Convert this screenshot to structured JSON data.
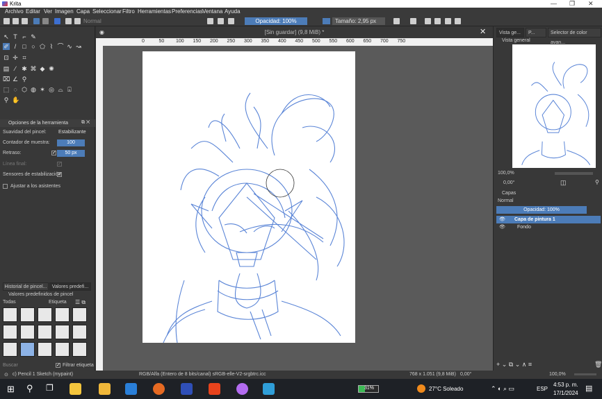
{
  "window": {
    "app_title": "Krita"
  },
  "menu": [
    "Archivo",
    "Editar",
    "Ver",
    "Imagen",
    "Capa",
    "Seleccionar",
    "Filtro",
    "Herramientas",
    "Preferencias",
    "Ventana",
    "Ayuda"
  ],
  "toolbar": {
    "blend_mode": "Normal",
    "opacity_label": "Opacidad: 100%",
    "size_label": "Tamaño: 2,95 px"
  },
  "document": {
    "tab_title": "[Sin guardar]  (9,8 MiB) *",
    "ruler_ticks": [
      "0",
      "50",
      "100",
      "150",
      "200",
      "250",
      "300",
      "350",
      "400",
      "450",
      "500",
      "550",
      "600",
      "650",
      "700",
      "750"
    ]
  },
  "tool_options": {
    "title": "Opciones de la herramienta",
    "smoothing_label": "Suavidad del pincel:",
    "smoothing_value": "Estabilizante",
    "sample_count_label": "Contador de muestra:",
    "sample_count_value": "100",
    "delay_label": "Retraso:",
    "delay_value": "50 px",
    "finish_line_label": "Línea final:",
    "stabilize_sensors_label": "Sensores de estabilización:",
    "snap_assistants_label": "Ajustar a los asistentes"
  },
  "brush_presets": {
    "tab_history": "Historial de pincel...",
    "tab_presets": "Valores predefi...",
    "title": "Valores predefinidos de pincel",
    "filter_all": "Todas",
    "tag_label": "Etiqueta",
    "search_placeholder": "Buscar",
    "filter_tag_label": "Filtrar etiqueta"
  },
  "right_panel": {
    "tab_overview": "Vista ge...",
    "tab_p": "P...",
    "tab_color_selector": "Selector de color avan...",
    "overview_title": "Vista general",
    "zoom": "100,0%",
    "rotation": "0,00°",
    "layers_title": "Capas",
    "layer_blend": "Normal",
    "layer_opacity": "Opacidad: 100%",
    "layers": [
      {
        "name": "Capa de pintura 1",
        "selected": true
      },
      {
        "name": "Fondo",
        "selected": false
      }
    ]
  },
  "status": {
    "brush": "c) Pencil 1 Sketch (mypaint)",
    "color_space": "RGB/Alfa (Entero de 8 bits/canal)  sRGB-elle-V2-srgbtrc.icc",
    "dimensions": "768 x 1.051 (9,8 MiB)",
    "rotation": "0,00°",
    "zoom": "100,0%"
  },
  "taskbar": {
    "battery": "31%",
    "weather": "27°C Soleado",
    "lang": "ESP",
    "time": "4:53 p. m.",
    "date": "17/1/2024"
  },
  "colors": {
    "accent": "#4c7cb8",
    "sketch_stroke": "#3d6fd0",
    "panel_bg": "#383838"
  }
}
